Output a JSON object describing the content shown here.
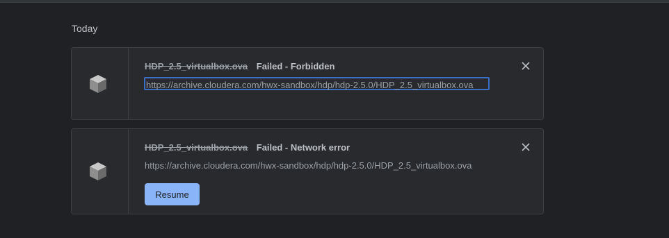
{
  "section": {
    "date_label": "Today"
  },
  "downloads": [
    {
      "file_name": "HDP_2.5_virtualbox.ova",
      "status": "Failed - Forbidden",
      "url": "https://archive.cloudera.com/hwx-sandbox/hdp/hdp-2.5.0/HDP_2.5_virtualbox.ova",
      "icon": "package-icon",
      "focused_url": true
    },
    {
      "file_name": "HDP_2.5_virtualbox.ova",
      "status": "Failed - Network error",
      "url": "https://archive.cloudera.com/hwx-sandbox/hdp/hdp-2.5.0/HDP_2.5_virtualbox.ova",
      "icon": "package-icon",
      "action_label": "Resume"
    }
  ],
  "colors": {
    "background": "#202124",
    "card": "#292a2d",
    "accent": "#8ab4f8",
    "focus_ring": "#3b6fc4"
  }
}
